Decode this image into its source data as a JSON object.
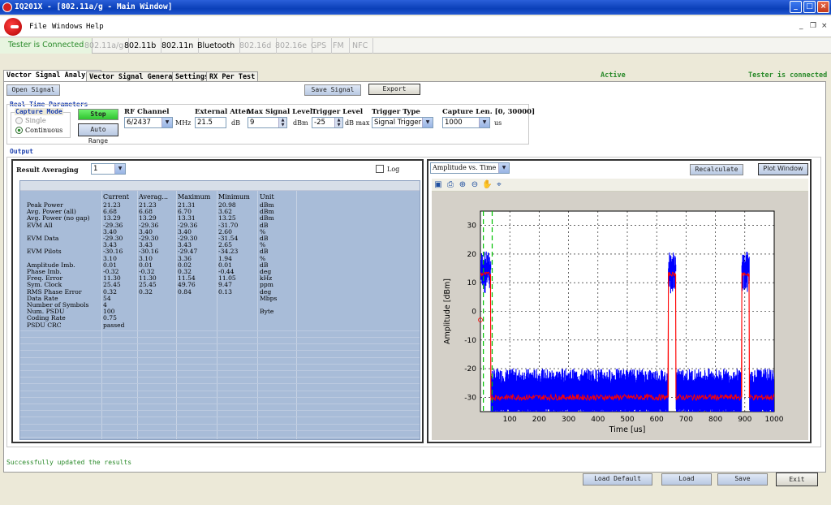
{
  "window": {
    "title": "IQ201X - [802.11a/g - Main Window]"
  },
  "menu": {
    "file": "File",
    "windows": "Windows",
    "help": "Help"
  },
  "toolbar": {
    "status": "Tester is Connected",
    "tabs": [
      {
        "label": "802.11a/g",
        "enabled": false
      },
      {
        "label": "802.11b",
        "enabled": true
      },
      {
        "label": "802.11n",
        "enabled": true
      },
      {
        "label": "Bluetooth",
        "enabled": true
      },
      {
        "label": "802.16d",
        "enabled": false
      },
      {
        "label": "802.16e",
        "enabled": false
      },
      {
        "label": "GPS",
        "enabled": false
      },
      {
        "label": "FM",
        "enabled": false
      },
      {
        "label": "NFC",
        "enabled": false
      }
    ]
  },
  "tabs": [
    "Vector Signal Analyzer",
    "Vector Signal Generator",
    "Settings",
    "RX Per Test"
  ],
  "status_active": "Active",
  "status_connected": "Tester is connected",
  "buttons": {
    "open_signal": "Open Signal",
    "save_signal": "Save Signal",
    "export": "Export",
    "stop": "Stop",
    "auto_range": "Auto Range",
    "recalculate": "Recalculate",
    "plot_window": "Plot Window",
    "load_default": "Load Default",
    "load": "Load",
    "save": "Save",
    "exit": "Exit"
  },
  "params": {
    "section": "Real Time Parameters",
    "capture_mode": "Capture Mode",
    "single": "Single",
    "continuous": "Continuous",
    "rf_channel_label": "RF Channel",
    "rf_channel": "6/2437",
    "rf_unit": "MHz",
    "ext_atten_label": "External Atten.",
    "ext_atten": "21.5",
    "ext_atten_unit": "dB",
    "max_level_label": "Max Signal Level",
    "max_level": "9",
    "max_level_unit": "dBm",
    "trigger_level_label": "Trigger Level",
    "trigger_level": "-25",
    "trigger_level_unit": "dB max",
    "trigger_type_label": "Trigger Type",
    "trigger_type": "Signal Trigger",
    "capture_len_label": "Capture Len. [0, 30000]",
    "capture_len": "1000",
    "capture_len_unit": "us"
  },
  "output": {
    "label": "Output",
    "averaging_label": "Result Averaging",
    "averaging": "1",
    "log_label": "Log",
    "plot_select": "Amplitude vs. Time"
  },
  "results": {
    "headers": [
      "",
      "Current",
      "Averag...",
      "Maximum",
      "Minimum",
      "Unit"
    ],
    "rows": [
      [
        "Peak Power",
        "21.23",
        "21.23",
        "21.31",
        "20.98",
        "dBm"
      ],
      [
        "Avg. Power (all)",
        "6.68",
        "6.68",
        "6.70",
        "3.62",
        "dBm"
      ],
      [
        "Avg. Power (no gap)",
        "13.29",
        "13.29",
        "13.31",
        "13.25",
        "dBm"
      ],
      [
        "EVM All",
        "-29.36",
        "-29.36",
        "-29.36",
        "-31.70",
        "dB"
      ],
      [
        "",
        "3.40",
        "3.40",
        "3.40",
        "2.60",
        "%"
      ],
      [
        "EVM Data",
        "-29.30",
        "-29.30",
        "-29.30",
        "-31.54",
        "dB"
      ],
      [
        "",
        "3.43",
        "3.43",
        "3.43",
        "2.65",
        "%"
      ],
      [
        "EVM Pilots",
        "-30.16",
        "-30.16",
        "-29.47",
        "-34.23",
        "dB"
      ],
      [
        "",
        "3.10",
        "3.10",
        "3.36",
        "1.94",
        "%"
      ],
      [
        "Amplitude Imb.",
        "0.01",
        "0.01",
        "0.02",
        "0.01",
        "dB"
      ],
      [
        "Phase Imb.",
        "-0.32",
        "-0.32",
        "0.32",
        "-0.44",
        "deg"
      ],
      [
        "Freq. Error",
        "11.30",
        "11.30",
        "11.54",
        "11.05",
        "kHz"
      ],
      [
        "Sym. Clock",
        "25.45",
        "25.45",
        "49.76",
        "9.47",
        "ppm"
      ],
      [
        "RMS Phase Error",
        "0.32",
        "0.32",
        "0.84",
        "0.13",
        "deg"
      ],
      [
        "Data Rate",
        "54",
        "",
        "",
        "",
        "Mbps"
      ],
      [
        "Number of Symbols",
        "4",
        "",
        "",
        "",
        ""
      ],
      [
        "Num. PSDU",
        "100",
        "",
        "",
        "",
        "Byte"
      ],
      [
        "Coding Rate",
        "0.75",
        "",
        "",
        "",
        ""
      ],
      [
        "PSDU CRC",
        "passed",
        "",
        "",
        "",
        ""
      ]
    ]
  },
  "chart_data": {
    "type": "line",
    "xlabel": "Time [us]",
    "ylabel": "Amplitude [dBm]",
    "xlim": [
      0,
      1000
    ],
    "ylim": [
      -35,
      35
    ],
    "xticks": [
      100,
      200,
      300,
      400,
      500,
      600,
      700,
      800,
      900,
      1000
    ],
    "yticks": [
      30,
      20,
      10,
      0,
      -10,
      -20,
      -30
    ],
    "grid": true,
    "bursts_us": [
      [
        0,
        35
      ],
      [
        640,
        665
      ],
      [
        890,
        915
      ]
    ],
    "series": [
      {
        "color": "#0000ff",
        "burst_level": 15,
        "burst_peak": 21,
        "noise_floor": -30,
        "noise_peak": -20
      },
      {
        "color": "#ff0000",
        "burst_level": 13,
        "noise_floor": -30
      }
    ],
    "markers_us": [
      10,
      40
    ]
  },
  "status_message": "Successfully updated the results"
}
